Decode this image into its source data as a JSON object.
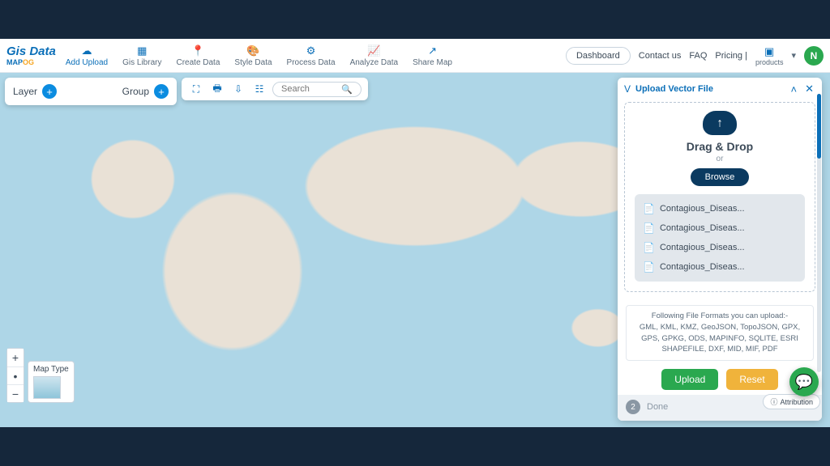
{
  "brand": {
    "top": "Gis Data",
    "map": "MAP",
    "og": "OG"
  },
  "nav": [
    {
      "icon": "☁",
      "label": "Add Upload",
      "active": true
    },
    {
      "icon": "▦",
      "label": "Gis Library"
    },
    {
      "icon": "📍",
      "label": "Create Data"
    },
    {
      "icon": "🎨",
      "label": "Style Data"
    },
    {
      "icon": "⚙",
      "label": "Process Data"
    },
    {
      "icon": "📈",
      "label": "Analyze Data"
    },
    {
      "icon": "↗",
      "label": "Share Map"
    }
  ],
  "topright": {
    "dashboard": "Dashboard",
    "contact": "Contact us",
    "faq": "FAQ",
    "pricing": "Pricing |",
    "products": "products",
    "avatar": "N"
  },
  "layer_card": {
    "layer": "Layer",
    "group": "Group"
  },
  "search": {
    "placeholder": "Search"
  },
  "maptype": {
    "label": "Map Type"
  },
  "upload_panel": {
    "title": "Upload Vector File",
    "drag_drop": "Drag & Drop",
    "or": "or",
    "browse": "Browse",
    "files": [
      "Contagious_Diseas...",
      "Contagious_Diseas...",
      "Contagious_Diseas...",
      "Contagious_Diseas..."
    ],
    "formats_title": "Following File Formats you can upload:-",
    "formats_body": "GML, KML, KMZ, GeoJSON, TopoJSON, GPX, GPS, GPKG, ODS, MAPINFO, SQLITE, ESRI SHAPEFILE, DXF, MID, MIF, PDF",
    "upload_btn": "Upload",
    "reset_btn": "Reset",
    "step": "2",
    "done": "Done"
  },
  "attribution": "Attribution"
}
